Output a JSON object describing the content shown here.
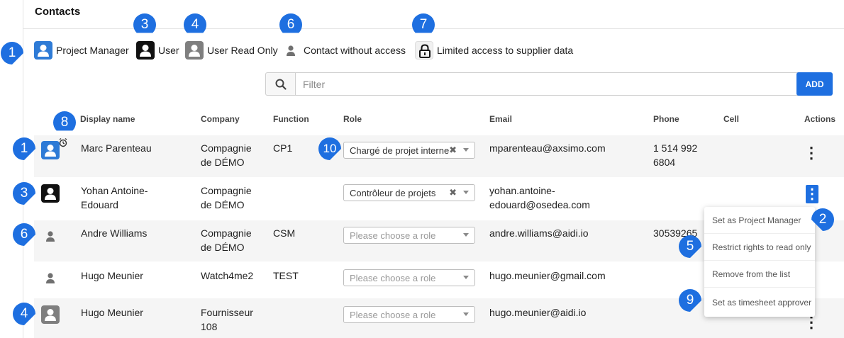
{
  "panel": {
    "title": "Contacts"
  },
  "legend": [
    {
      "label": "Project Manager",
      "icon": "project-manager-icon"
    },
    {
      "label": "User",
      "icon": "user-icon"
    },
    {
      "label": "User Read Only",
      "icon": "user-read-only-icon"
    },
    {
      "label": "Contact without access",
      "icon": "contact-icon"
    },
    {
      "label": "Limited access to supplier data",
      "icon": "lock-icon"
    }
  ],
  "filter": {
    "placeholder": "Filter"
  },
  "add_label": "ADD",
  "columns": {
    "display_name": "Display name",
    "company": "Company",
    "function": "Function",
    "role": "Role",
    "email": "Email",
    "phone": "Phone",
    "cell": "Cell",
    "actions": "Actions"
  },
  "rows": [
    {
      "type": "project-manager",
      "name": "Marc Parenteau",
      "company": "Compagnie de DÉMO",
      "function": "CP1",
      "role": "Chargé de projet interne",
      "email": "mparenteau@axsimo.com",
      "phone": "1 514 992 6804",
      "cell": ""
    },
    {
      "type": "user",
      "name": "Yohan Antoine-Edouard",
      "company": "Compagnie de DÉMO",
      "function": "",
      "role": "Contrôleur de projets",
      "email": "yohan.antoine-edouard@osedea.com",
      "phone": "",
      "cell": ""
    },
    {
      "type": "contact",
      "name": "Andre Williams",
      "company": "Compagnie de DÉMO",
      "function": "CSM",
      "role": "",
      "email": "andre.williams@aidi.io",
      "phone": "30539265",
      "cell": ""
    },
    {
      "type": "contact",
      "name": "Hugo Meunier",
      "company": "Watch4me2",
      "function": "TEST",
      "role": "",
      "email": "hugo.meunier@gmail.com",
      "phone": "",
      "cell": ""
    },
    {
      "type": "user-read-only",
      "name": "Hugo Meunier",
      "company": "Fournisseur 108",
      "function": "",
      "role": "",
      "email": "hugo.meunier@aidi.io",
      "phone": "",
      "cell": ""
    }
  ],
  "role_placeholder": "Please choose a role",
  "actions_menu": [
    "Set as Project Manager",
    "Restrict rights to read only",
    "Remove from the list",
    "Set as timesheet approver"
  ],
  "callouts": [
    "1",
    "3",
    "4",
    "6",
    "7",
    "8",
    "1",
    "10",
    "3",
    "6",
    "4",
    "2",
    "5",
    "9"
  ],
  "colors": {
    "accent": "#1e6fe0",
    "project_manager": "#2e7bd6",
    "user": "#111111",
    "read_only": "#7f7f7f",
    "callout": "#1e6fe0"
  }
}
